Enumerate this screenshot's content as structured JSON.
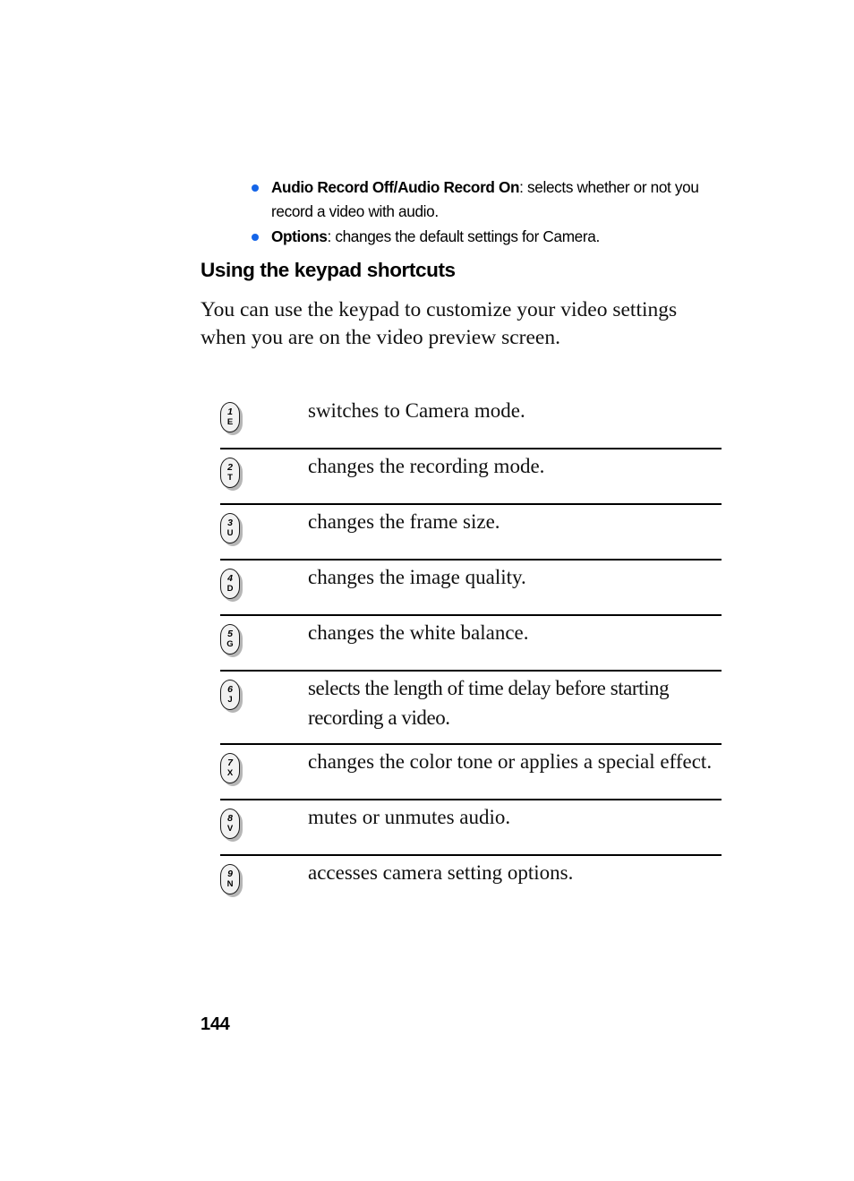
{
  "document": {
    "page_number": "144",
    "accent_bullet_color": "#1565E8"
  },
  "bullets": [
    {
      "term": "Audio Record Off/Audio Record On",
      "description": ": selects whether or not you record a video with audio."
    },
    {
      "term": "Options",
      "description": ": changes the default settings for Camera."
    }
  ],
  "section": {
    "heading": "Using the keypad shortcuts",
    "intro": "You can use the keypad to customize your video settings when you are on the video preview screen."
  },
  "shortcuts": [
    {
      "key_number": "1",
      "key_letter": "E",
      "description": "switches to Camera mode."
    },
    {
      "key_number": "2",
      "key_letter": "T",
      "description": "changes the recording mode."
    },
    {
      "key_number": "3",
      "key_letter": "U",
      "description": "changes the frame size."
    },
    {
      "key_number": "4",
      "key_letter": "D",
      "description": "changes the image quality."
    },
    {
      "key_number": "5",
      "key_letter": "G",
      "description": "changes the white balance."
    },
    {
      "key_number": "6",
      "key_letter": "J",
      "description": "selects the length of time delay before starting recording a video."
    },
    {
      "key_number": "7",
      "key_letter": "X",
      "description": "changes the color tone or applies a special effect."
    },
    {
      "key_number": "8",
      "key_letter": "V",
      "description": "mutes or unmutes audio."
    },
    {
      "key_number": "9",
      "key_letter": "N",
      "description": "accesses camera setting options."
    }
  ]
}
